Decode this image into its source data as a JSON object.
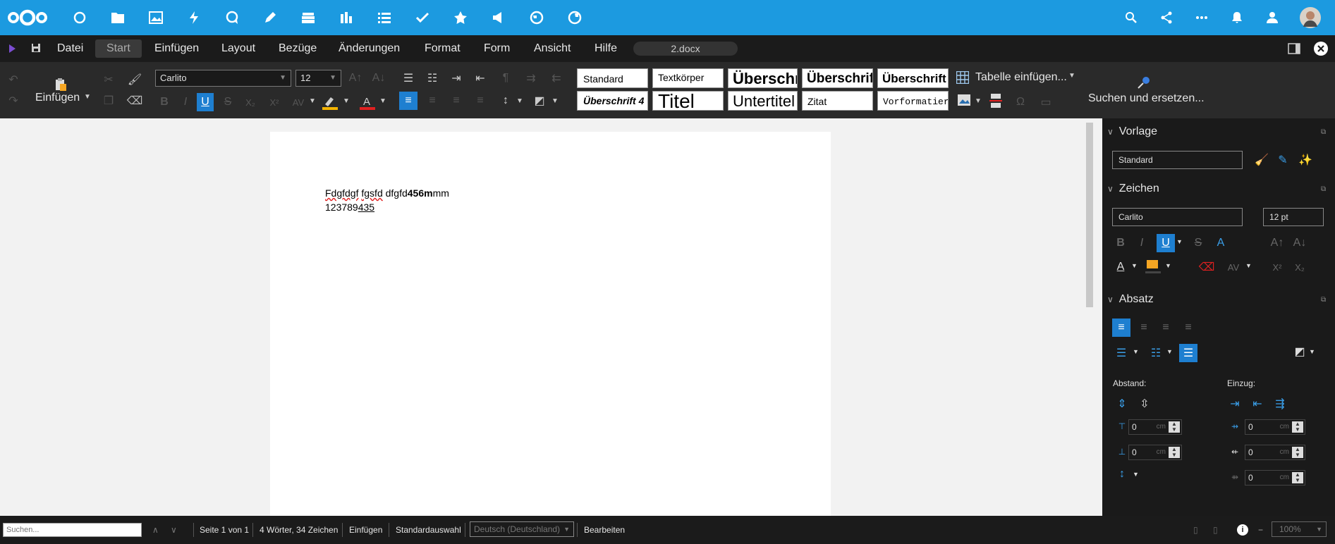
{
  "menubar": {
    "items": [
      "Datei",
      "Start",
      "Einfügen",
      "Layout",
      "Bezüge",
      "Änderungen",
      "Format",
      "Form",
      "Ansicht",
      "Hilfe"
    ],
    "document_name": "2.docx"
  },
  "toolbar": {
    "paste_label": "Einfügen",
    "font_name": "Carlito",
    "font_size": "12",
    "styles": [
      "Standard",
      "Textkörper",
      "Überschr",
      "Überschrift",
      "Überschrift",
      "Überschrift 4",
      "Titel",
      "Untertitel",
      "Zitat",
      "Vorformatiert"
    ],
    "insert_table_label": "Tabelle einfügen...",
    "find_replace_label": "Suchen und ersetzen...",
    "colors": {
      "accent": "#1c9ae0",
      "highlight": "#f5b400",
      "font_color": "#e02020"
    }
  },
  "document": {
    "line1_a": "Fdgfdgf",
    "line1_b": "fgsfd",
    "line1_c": "dfgfd",
    "line1_bold": "456m",
    "line1_d": "mm",
    "line2_a": "123789",
    "line2_b": "435"
  },
  "sidebar": {
    "vorlage_title": "Vorlage",
    "style_value": "Standard",
    "zeichen_title": "Zeichen",
    "font_value": "Carlito",
    "size_value": "12 pt",
    "absatz_title": "Absatz",
    "abstand_label": "Abstand:",
    "einzug_label": "Einzug:",
    "spin_values": [
      "0",
      "0",
      "0",
      "0",
      "0"
    ],
    "unit": "cm"
  },
  "status": {
    "search_placeholder": "Suchen...",
    "page": "Seite 1 von 1",
    "words": "4 Wörter, 34 Zeichen",
    "mode": "Einfügen",
    "selection": "Standardauswahl",
    "language": "Deutsch (Deutschland)",
    "edit": "Bearbeiten",
    "zoom": "100%"
  }
}
